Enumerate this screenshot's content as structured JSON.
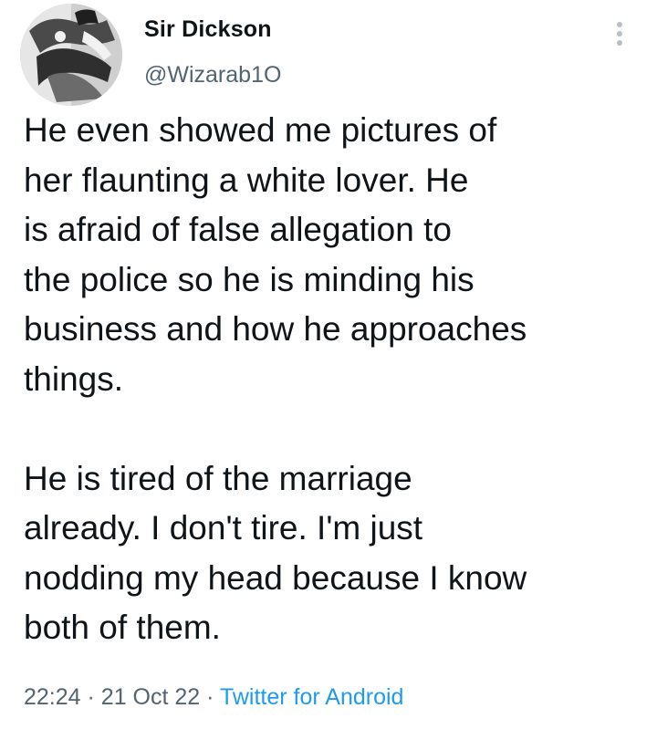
{
  "tweet": {
    "author": {
      "name": "Sir Dickson",
      "handle": "@Wizarab1O"
    },
    "body_lines": [
      "He even showed me pictures of",
      "her flaunting a white lover. He",
      "is afraid of false allegation to",
      "the police so he is minding his",
      "business and how he approaches",
      "things.",
      "",
      "He is tired of the marriage",
      "already. I don't tire. I'm just",
      "nodding my head because I know",
      "both of them."
    ],
    "meta": {
      "time": "22:24",
      "separator": "·",
      "date": "21 Oct 22",
      "source": "Twitter for Android"
    }
  },
  "icons": {
    "more": "vertical-ellipsis-icon",
    "avatar": "profile-photo-avatar"
  },
  "colors": {
    "text": "#0f1419",
    "secondary": "#536471",
    "link": "#1d9bf0",
    "icon": "#b8c0c7"
  }
}
